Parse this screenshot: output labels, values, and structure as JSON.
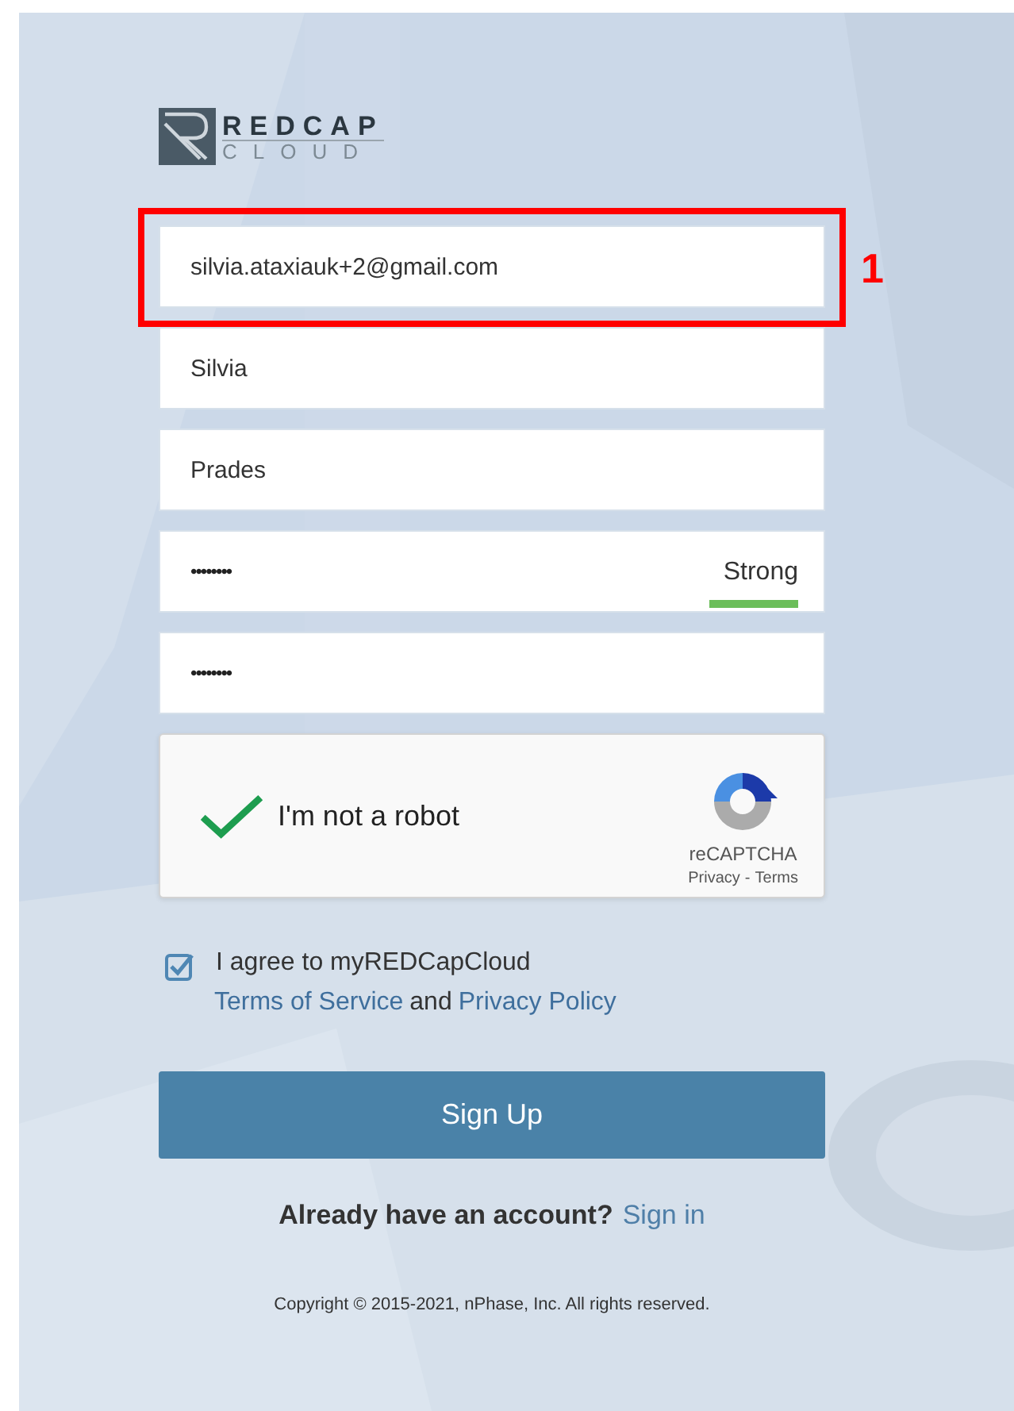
{
  "logo": {
    "word_top": "REDCAP",
    "word_bottom": "CLOUD"
  },
  "fields": [
    {
      "kind": "text",
      "value": "silvia.ataxiauk+2@gmail.com",
      "annotation": "1"
    },
    {
      "kind": "text",
      "value": "Silvia"
    },
    {
      "kind": "text",
      "value": "Prades"
    },
    {
      "kind": "password",
      "value": "••••••••",
      "strength": {
        "label": "Strong",
        "level": 1
      }
    },
    {
      "kind": "password",
      "value": "••••••••"
    }
  ],
  "captcha": {
    "checked": true,
    "label": "I'm not a robot",
    "brand": "reCAPTCHA",
    "privacy": "Privacy",
    "separator": "-",
    "terms": "Terms"
  },
  "agreement": {
    "checked": true,
    "text": "I agree to myREDCapCloud",
    "terms_link": "Terms of Service",
    "joiner": "and",
    "privacy_link": "Privacy Policy"
  },
  "submit": "Sign Up",
  "signin": {
    "question": "Already have an account?",
    "link": "Sign in"
  },
  "copyright": "Copyright © 2015-2021, nPhase, Inc. All rights reserved."
}
